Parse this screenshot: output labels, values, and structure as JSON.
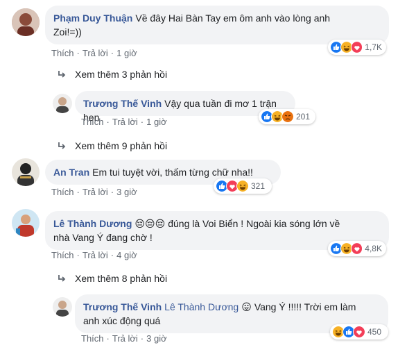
{
  "action_labels": {
    "like": "Thích",
    "reply": "Trả lời",
    "sep": "·"
  },
  "comments": [
    {
      "author": "Phạm Duy Thuận",
      "text_line1": "Về đây Hai Bàn Tay em ôm anh vào lòng anh",
      "text_line2": "Zoi!=))",
      "time": "1 giờ",
      "reactions": [
        "like",
        "haha",
        "love"
      ],
      "reaction_count": "1,7K"
    },
    {
      "author": "Trương Thế Vinh",
      "text": "Vậy qua tuần đi mơ 1 trận hen",
      "time": "1 giờ",
      "reactions": [
        "like",
        "haha",
        "angry"
      ],
      "reaction_count": "201"
    },
    {
      "author": "An Tran",
      "text": "Em tui tuyệt vời, thấm từng chữ nha!!",
      "time": "3 giờ",
      "reactions": [
        "like",
        "love",
        "haha"
      ],
      "reaction_count": "321"
    },
    {
      "author": "Lê Thành Dương",
      "emoji": "😔😔😔",
      "text_line1": "đúng là Voi Biển ! Ngoài kia sóng lớn về",
      "text_line2": "nhà Vang Ý đang chờ !",
      "time": "4 giờ",
      "reactions": [
        "like",
        "haha",
        "love"
      ],
      "reaction_count": "4,8K"
    },
    {
      "author": "Trương Thế Vinh",
      "mention": "Lê Thành Dương",
      "emoji": "😛",
      "text_line1": "Vang Ý !!!!! Trời em làm",
      "text_line2": "anh xúc động quá",
      "time": "3 giờ",
      "reactions": [
        "haha",
        "like",
        "love"
      ],
      "reaction_count": "450"
    }
  ],
  "more_replies": [
    "Xem thêm 3 phản hồi",
    "Xem thêm 9 phản hồi",
    "Xem thêm 8 phản hồi"
  ],
  "colors": {
    "author": "#385898",
    "bubble": "#f2f3f5",
    "meta": "#606770",
    "like": "#1877f2",
    "love": "#f33e58",
    "haha": "#f7b125"
  }
}
